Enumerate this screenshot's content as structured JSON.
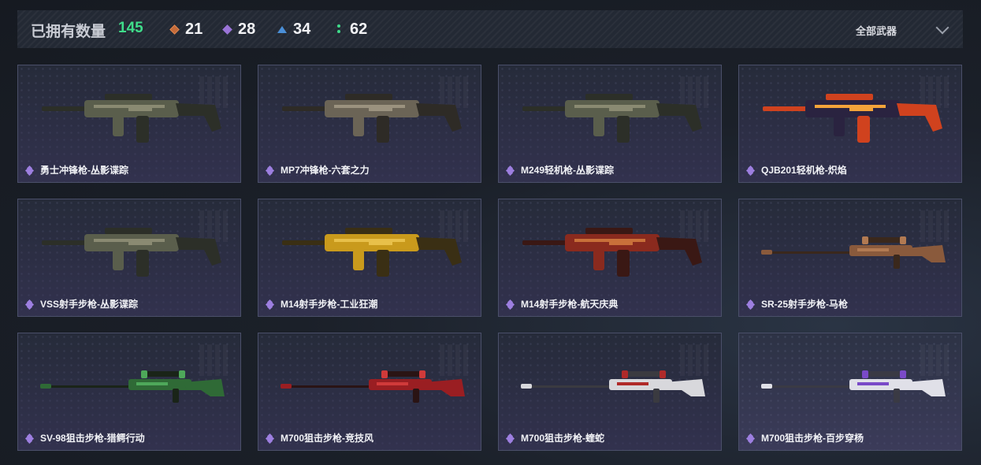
{
  "header": {
    "owned_label": "已拥有数量",
    "owned_count": "145",
    "stats": [
      {
        "icon": "orange-diamond-icon",
        "value": "21"
      },
      {
        "icon": "purple-diamond-icon",
        "value": "28"
      },
      {
        "icon": "blue-triangle-icon",
        "value": "34"
      },
      {
        "icon": "green-dots-icon",
        "value": "62"
      }
    ],
    "filter": {
      "label": "全部武器",
      "icon": "chevron-down-icon"
    }
  },
  "colors": {
    "accent_green": "#3fdc8a",
    "rarity_purple": "#9d7fe0",
    "rarity_orange": "#c56b3a",
    "rarity_blue": "#4a8fd8"
  },
  "weapons": [
    {
      "name": "勇士冲锋枪-丛影谍踪",
      "rarity": "purple",
      "skin": "camo"
    },
    {
      "name": "MP7冲锋枪-六套之力",
      "rarity": "purple",
      "skin": "desert"
    },
    {
      "name": "M249轻机枪-丛影谍踪",
      "rarity": "purple",
      "skin": "camo"
    },
    {
      "name": "QJB201轻机枪-炽焰",
      "rarity": "purple",
      "skin": "flame"
    },
    {
      "name": "VSS射手步枪-丛影谍踪",
      "rarity": "purple",
      "skin": "camo"
    },
    {
      "name": "M14射手步枪-工业狂潮",
      "rarity": "purple",
      "skin": "yellow"
    },
    {
      "name": "M14射手步枪-航天庆典",
      "rarity": "purple",
      "skin": "red"
    },
    {
      "name": "SR-25射手步枪-马枪",
      "rarity": "purple",
      "skin": "copper"
    },
    {
      "name": "SV-98狙击步枪-猎鳄行动",
      "rarity": "purple",
      "skin": "green"
    },
    {
      "name": "M700狙击步枪-竞技风",
      "rarity": "purple",
      "skin": "redsniper"
    },
    {
      "name": "M700狙击步枪-蝰蛇",
      "rarity": "purple",
      "skin": "whitered"
    },
    {
      "name": "M700狙击步枪-百步穿杨",
      "rarity": "purple",
      "skin": "whitepurple"
    }
  ]
}
